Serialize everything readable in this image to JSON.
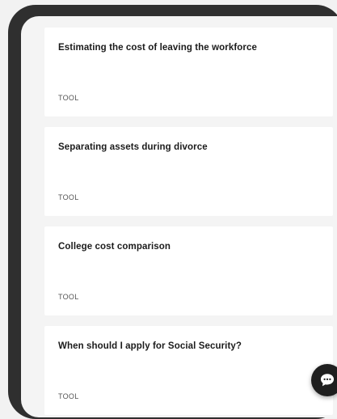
{
  "cards": [
    {
      "title": "Estimating the cost of leaving the workforce",
      "tag": "TOOL"
    },
    {
      "title": "Separating assets during divorce",
      "tag": "TOOL"
    },
    {
      "title": "College cost comparison",
      "tag": "TOOL"
    },
    {
      "title": "When should I apply for Social Security?",
      "tag": "TOOL"
    }
  ],
  "chat": {
    "icon": "chat-bubble-icon"
  },
  "colors": {
    "frame": "#2f2f2f",
    "background": "#f4f4f4",
    "card": "#ffffff",
    "chat_button": "#1f1f1f"
  }
}
